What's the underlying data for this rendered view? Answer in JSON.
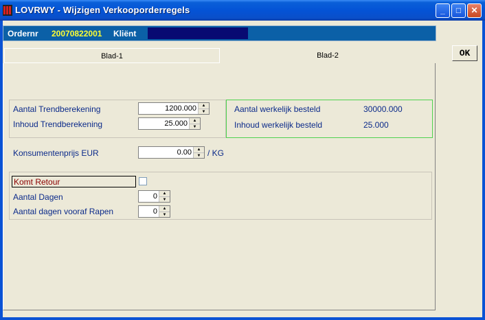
{
  "window": {
    "title": "LOVRWY - Wijzigen Verkooporderregels",
    "minimize": "_",
    "maximize": "□",
    "close": "✕"
  },
  "header": {
    "order_label": "Ordernr",
    "order_value": "20070822001",
    "client_label": "Kliënt"
  },
  "tabs": [
    {
      "label": "Blad-1"
    },
    {
      "label": "Blad-2"
    }
  ],
  "ok_label": "OK",
  "trend": {
    "aantal_label": "Aantal Trendberekening",
    "aantal_value": "1200.000",
    "inhoud_label": "Inhoud Trendberekening",
    "inhoud_value": "25.000"
  },
  "besteld": {
    "aantal_label": "Aantal werkelijk besteld",
    "aantal_value": "30000.000",
    "inhoud_label": "Inhoud werkelijk besteld",
    "inhoud_value": "25.000"
  },
  "price": {
    "label": "Konsumentenprijs EUR",
    "value": "0.00",
    "unit": "/ KG"
  },
  "retour": {
    "label": "Komt Retour",
    "dagen_label": "Aantal Dagen",
    "dagen_value": "0",
    "vooraf_label": "Aantal dagen vooraf Rapen",
    "vooraf_value": "0"
  }
}
